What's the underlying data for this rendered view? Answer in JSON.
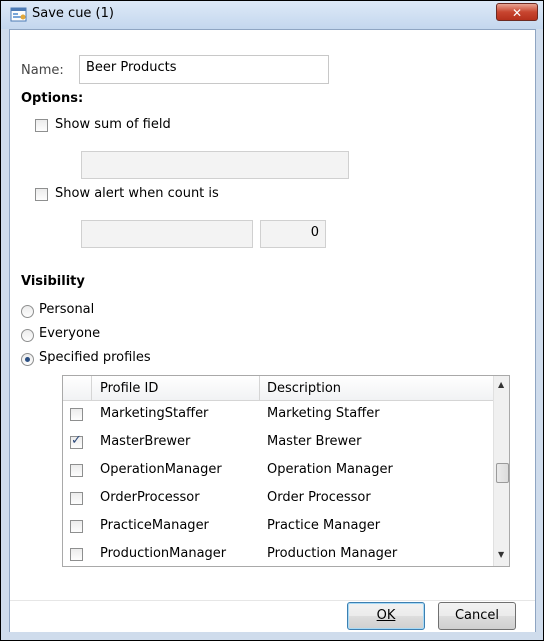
{
  "window": {
    "title": "Save cue (1)",
    "close_glyph": "✕"
  },
  "form": {
    "name_label": "Name:",
    "name_value": "Beer Products",
    "options_heading": "Options:",
    "show_sum_label": "Show sum of field",
    "show_sum_checked": false,
    "sum_field_value": "",
    "show_alert_label": "Show alert when count is",
    "show_alert_checked": false,
    "alert_operator_value": "",
    "alert_count_value": "0"
  },
  "visibility": {
    "heading": "Visibility",
    "options": [
      "Personal",
      "Everyone",
      "Specified profiles"
    ],
    "selected": "Specified profiles"
  },
  "profiles_grid": {
    "columns": [
      "Profile ID",
      "Description"
    ],
    "rows": [
      {
        "id": "MarketingStaffer",
        "description": "Marketing Staffer",
        "checked": false
      },
      {
        "id": "MasterBrewer",
        "description": "Master Brewer",
        "checked": true
      },
      {
        "id": "OperationManager",
        "description": "Operation Manager",
        "checked": false
      },
      {
        "id": "OrderProcessor",
        "description": "Order Processor",
        "checked": false
      },
      {
        "id": "PracticeManager",
        "description": "Practice Manager",
        "checked": false
      },
      {
        "id": "ProductionManager",
        "description": "Production Manager",
        "checked": false
      }
    ]
  },
  "buttons": {
    "ok_label": "OK",
    "cancel_label": "Cancel"
  },
  "icons": {
    "title_icon": "form-icon",
    "close": "close-icon",
    "scroll_up": "chevron-up-icon",
    "scroll_down": "chevron-down-icon",
    "check": "check-icon"
  },
  "colors": {
    "title_bg": "#c4d7ee",
    "close_bg": "#c8452f",
    "default_button_border": "#3c7fb1"
  }
}
